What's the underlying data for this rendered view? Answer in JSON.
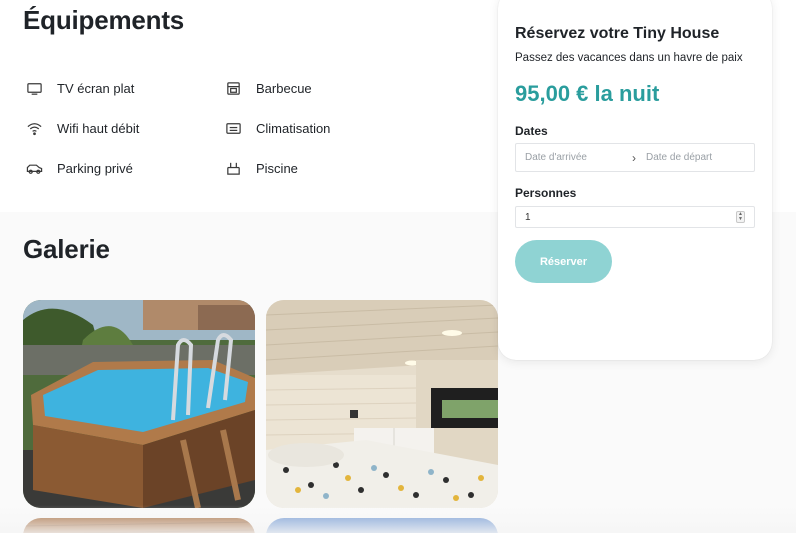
{
  "equipment": {
    "title": "Équipements",
    "items": [
      {
        "label": "TV écran plat",
        "icon": "tv-icon"
      },
      {
        "label": "Barbecue",
        "icon": "barbecue-icon"
      },
      {
        "label": "Wifi haut débit",
        "icon": "wifi-icon"
      },
      {
        "label": "Climatisation",
        "icon": "air-conditioning-icon"
      },
      {
        "label": "Parking privé",
        "icon": "car-icon"
      },
      {
        "label": "Piscine",
        "icon": "pool-icon"
      }
    ]
  },
  "gallery": {
    "title": "Galerie",
    "photos": [
      "pool-photo",
      "bedroom-photo",
      "wood-deck-photo",
      "blue-photo"
    ]
  },
  "booking": {
    "title": "Réservez votre Tiny House",
    "subtitle": "Passez des vacances dans un havre de paix",
    "price": "95,00 € la nuit",
    "dates_label": "Dates",
    "arrival_placeholder": "Date d'arrivée",
    "departure_placeholder": "Date de départ",
    "persons_label": "Personnes",
    "persons_value": "1",
    "reserve_label": "Réserver"
  },
  "colors": {
    "accent": "#2a9d9d",
    "button": "#8fd3d3"
  }
}
